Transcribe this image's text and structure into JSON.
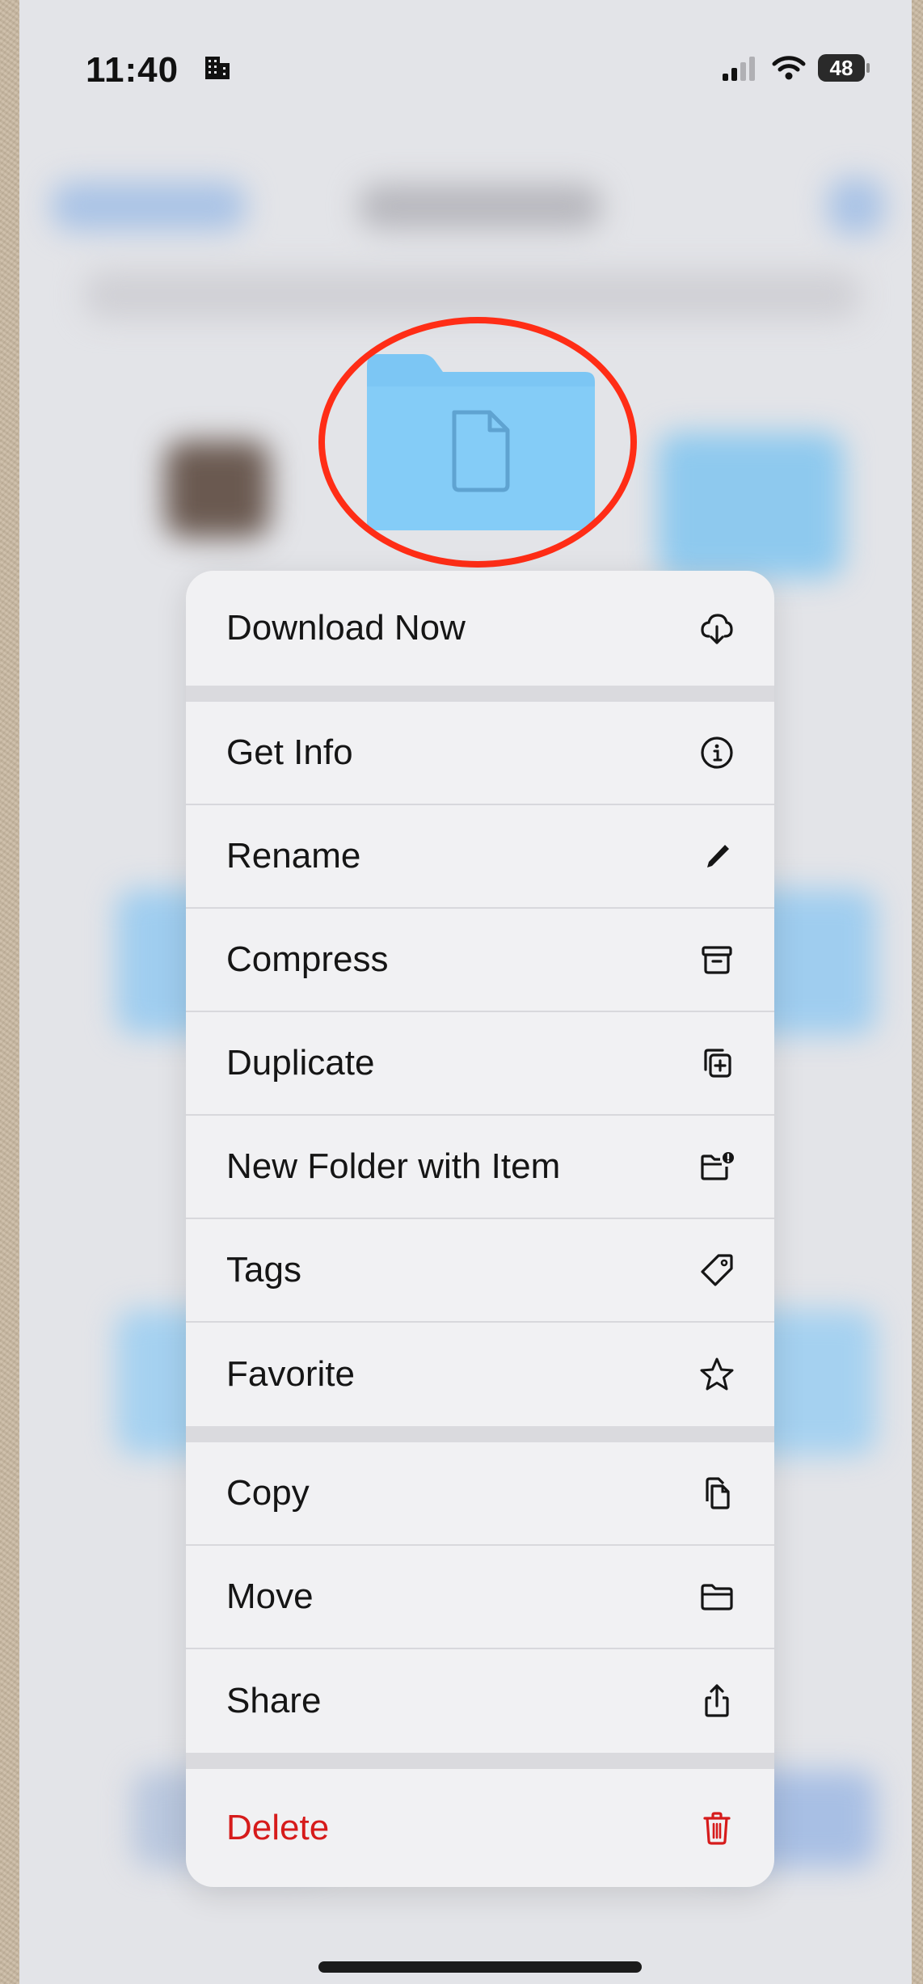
{
  "status_bar": {
    "time": "11:40",
    "battery": "48"
  },
  "menu": {
    "groups": [
      [
        {
          "label": "Download Now",
          "icon": "cloud-download-icon"
        }
      ],
      [
        {
          "label": "Get Info",
          "icon": "info-icon"
        },
        {
          "label": "Rename",
          "icon": "pencil-icon"
        },
        {
          "label": "Compress",
          "icon": "archive-box-icon"
        },
        {
          "label": "Duplicate",
          "icon": "duplicate-icon"
        },
        {
          "label": "New Folder with Item",
          "icon": "folder-badge-icon"
        },
        {
          "label": "Tags",
          "icon": "tag-icon"
        },
        {
          "label": "Favorite",
          "icon": "star-icon"
        }
      ],
      [
        {
          "label": "Copy",
          "icon": "copy-icon"
        },
        {
          "label": "Move",
          "icon": "folder-icon"
        },
        {
          "label": "Share",
          "icon": "share-icon"
        }
      ],
      [
        {
          "label": "Delete",
          "icon": "trash-icon",
          "color": "#d61b1b"
        }
      ]
    ]
  },
  "colors": {
    "highlight_ring": "#ff2d16",
    "folder": "#7cc6f4",
    "destructive": "#d61b1b"
  }
}
